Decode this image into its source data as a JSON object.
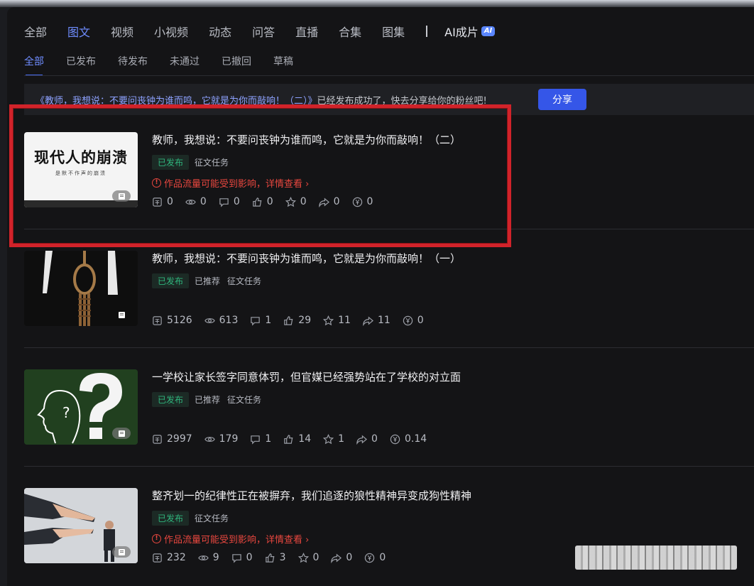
{
  "tabs": [
    {
      "label": "全部"
    },
    {
      "label": "图文"
    },
    {
      "label": "视频"
    },
    {
      "label": "小视频"
    },
    {
      "label": "动态"
    },
    {
      "label": "问答"
    },
    {
      "label": "直播"
    },
    {
      "label": "合集"
    },
    {
      "label": "图集"
    }
  ],
  "ai_tab": {
    "label": "AI成片",
    "badge": "AI"
  },
  "subtabs": [
    {
      "label": "全部"
    },
    {
      "label": "已发布"
    },
    {
      "label": "待发布"
    },
    {
      "label": "未通过"
    },
    {
      "label": "已撤回"
    },
    {
      "label": "草稿"
    }
  ],
  "notice": {
    "title_part": "《教师，我想说：不要问丧钟为谁而鸣，它就是为你而敲响！（二）》",
    "rest": "已经发布成功了，快去分享给你的粉丝吧!",
    "share_label": "分享"
  },
  "articles": [
    {
      "title": "教师，我想说：不要问丧钟为谁而鸣，它就是为你而敲响！（二）",
      "thumb_text": "现代人的崩溃",
      "thumb_sub": "是默不作声的崩溃",
      "tags": [
        "已发布",
        "征文任务"
      ],
      "warning": "作品流量可能受到影响，详情查看 ›",
      "stats": {
        "show": "0",
        "read": "0",
        "comment": "0",
        "like": "0",
        "fav": "0",
        "share": "0",
        "income": "0"
      }
    },
    {
      "title": "教师，我想说：不要问丧钟为谁而鸣，它就是为你而敲响！（一）",
      "tags": [
        "已发布",
        "已推荐",
        "征文任务"
      ],
      "stats": {
        "show": "5126",
        "read": "613",
        "comment": "1",
        "like": "29",
        "fav": "11",
        "share": "11",
        "income": "0"
      }
    },
    {
      "title": "一学校让家长签字同意体罚，但官媒已经强势站在了学校的对立面",
      "tags": [
        "已发布",
        "已推荐",
        "征文任务"
      ],
      "stats": {
        "show": "2997",
        "read": "179",
        "comment": "1",
        "like": "14",
        "fav": "1",
        "share": "0",
        "income": "0.14"
      }
    },
    {
      "title": "整齐划一的纪律性正在被摒弃，我们追逐的狼性精神异变成狗性精神",
      "tags": [
        "已发布",
        "征文任务"
      ],
      "warning": "作品流量可能受到影响，详情查看 ›",
      "stats": {
        "show": "232",
        "read": "9",
        "comment": "0",
        "like": "3",
        "fav": "0",
        "share": "0",
        "income": "0"
      }
    }
  ],
  "colors": {
    "accent": "#6f8dff",
    "published": "#2fb47c",
    "warning": "#e9473f",
    "highlight": "#d1232a"
  }
}
